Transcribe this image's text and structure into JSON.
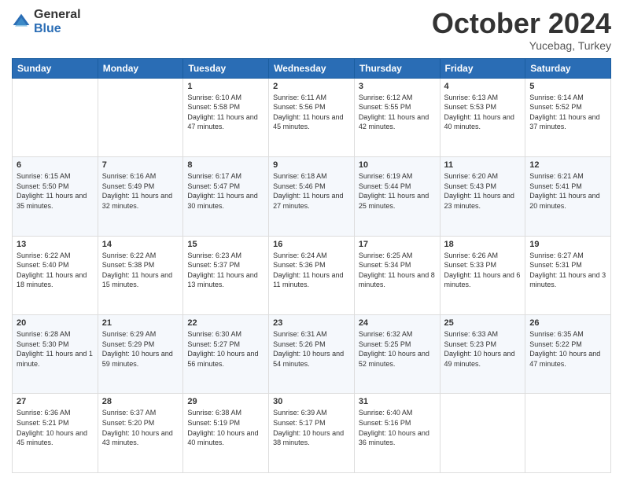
{
  "logo": {
    "general": "General",
    "blue": "Blue"
  },
  "header": {
    "month": "October 2024",
    "location": "Yucebag, Turkey"
  },
  "days": [
    "Sunday",
    "Monday",
    "Tuesday",
    "Wednesday",
    "Thursday",
    "Friday",
    "Saturday"
  ],
  "weeks": [
    [
      {
        "day": "",
        "sunrise": "",
        "sunset": "",
        "daylight": ""
      },
      {
        "day": "",
        "sunrise": "",
        "sunset": "",
        "daylight": ""
      },
      {
        "day": "1",
        "sunrise": "Sunrise: 6:10 AM",
        "sunset": "Sunset: 5:58 PM",
        "daylight": "Daylight: 11 hours and 47 minutes."
      },
      {
        "day": "2",
        "sunrise": "Sunrise: 6:11 AM",
        "sunset": "Sunset: 5:56 PM",
        "daylight": "Daylight: 11 hours and 45 minutes."
      },
      {
        "day": "3",
        "sunrise": "Sunrise: 6:12 AM",
        "sunset": "Sunset: 5:55 PM",
        "daylight": "Daylight: 11 hours and 42 minutes."
      },
      {
        "day": "4",
        "sunrise": "Sunrise: 6:13 AM",
        "sunset": "Sunset: 5:53 PM",
        "daylight": "Daylight: 11 hours and 40 minutes."
      },
      {
        "day": "5",
        "sunrise": "Sunrise: 6:14 AM",
        "sunset": "Sunset: 5:52 PM",
        "daylight": "Daylight: 11 hours and 37 minutes."
      }
    ],
    [
      {
        "day": "6",
        "sunrise": "Sunrise: 6:15 AM",
        "sunset": "Sunset: 5:50 PM",
        "daylight": "Daylight: 11 hours and 35 minutes."
      },
      {
        "day": "7",
        "sunrise": "Sunrise: 6:16 AM",
        "sunset": "Sunset: 5:49 PM",
        "daylight": "Daylight: 11 hours and 32 minutes."
      },
      {
        "day": "8",
        "sunrise": "Sunrise: 6:17 AM",
        "sunset": "Sunset: 5:47 PM",
        "daylight": "Daylight: 11 hours and 30 minutes."
      },
      {
        "day": "9",
        "sunrise": "Sunrise: 6:18 AM",
        "sunset": "Sunset: 5:46 PM",
        "daylight": "Daylight: 11 hours and 27 minutes."
      },
      {
        "day": "10",
        "sunrise": "Sunrise: 6:19 AM",
        "sunset": "Sunset: 5:44 PM",
        "daylight": "Daylight: 11 hours and 25 minutes."
      },
      {
        "day": "11",
        "sunrise": "Sunrise: 6:20 AM",
        "sunset": "Sunset: 5:43 PM",
        "daylight": "Daylight: 11 hours and 23 minutes."
      },
      {
        "day": "12",
        "sunrise": "Sunrise: 6:21 AM",
        "sunset": "Sunset: 5:41 PM",
        "daylight": "Daylight: 11 hours and 20 minutes."
      }
    ],
    [
      {
        "day": "13",
        "sunrise": "Sunrise: 6:22 AM",
        "sunset": "Sunset: 5:40 PM",
        "daylight": "Daylight: 11 hours and 18 minutes."
      },
      {
        "day": "14",
        "sunrise": "Sunrise: 6:22 AM",
        "sunset": "Sunset: 5:38 PM",
        "daylight": "Daylight: 11 hours and 15 minutes."
      },
      {
        "day": "15",
        "sunrise": "Sunrise: 6:23 AM",
        "sunset": "Sunset: 5:37 PM",
        "daylight": "Daylight: 11 hours and 13 minutes."
      },
      {
        "day": "16",
        "sunrise": "Sunrise: 6:24 AM",
        "sunset": "Sunset: 5:36 PM",
        "daylight": "Daylight: 11 hours and 11 minutes."
      },
      {
        "day": "17",
        "sunrise": "Sunrise: 6:25 AM",
        "sunset": "Sunset: 5:34 PM",
        "daylight": "Daylight: 11 hours and 8 minutes."
      },
      {
        "day": "18",
        "sunrise": "Sunrise: 6:26 AM",
        "sunset": "Sunset: 5:33 PM",
        "daylight": "Daylight: 11 hours and 6 minutes."
      },
      {
        "day": "19",
        "sunrise": "Sunrise: 6:27 AM",
        "sunset": "Sunset: 5:31 PM",
        "daylight": "Daylight: 11 hours and 3 minutes."
      }
    ],
    [
      {
        "day": "20",
        "sunrise": "Sunrise: 6:28 AM",
        "sunset": "Sunset: 5:30 PM",
        "daylight": "Daylight: 11 hours and 1 minute."
      },
      {
        "day": "21",
        "sunrise": "Sunrise: 6:29 AM",
        "sunset": "Sunset: 5:29 PM",
        "daylight": "Daylight: 10 hours and 59 minutes."
      },
      {
        "day": "22",
        "sunrise": "Sunrise: 6:30 AM",
        "sunset": "Sunset: 5:27 PM",
        "daylight": "Daylight: 10 hours and 56 minutes."
      },
      {
        "day": "23",
        "sunrise": "Sunrise: 6:31 AM",
        "sunset": "Sunset: 5:26 PM",
        "daylight": "Daylight: 10 hours and 54 minutes."
      },
      {
        "day": "24",
        "sunrise": "Sunrise: 6:32 AM",
        "sunset": "Sunset: 5:25 PM",
        "daylight": "Daylight: 10 hours and 52 minutes."
      },
      {
        "day": "25",
        "sunrise": "Sunrise: 6:33 AM",
        "sunset": "Sunset: 5:23 PM",
        "daylight": "Daylight: 10 hours and 49 minutes."
      },
      {
        "day": "26",
        "sunrise": "Sunrise: 6:35 AM",
        "sunset": "Sunset: 5:22 PM",
        "daylight": "Daylight: 10 hours and 47 minutes."
      }
    ],
    [
      {
        "day": "27",
        "sunrise": "Sunrise: 6:36 AM",
        "sunset": "Sunset: 5:21 PM",
        "daylight": "Daylight: 10 hours and 45 minutes."
      },
      {
        "day": "28",
        "sunrise": "Sunrise: 6:37 AM",
        "sunset": "Sunset: 5:20 PM",
        "daylight": "Daylight: 10 hours and 43 minutes."
      },
      {
        "day": "29",
        "sunrise": "Sunrise: 6:38 AM",
        "sunset": "Sunset: 5:19 PM",
        "daylight": "Daylight: 10 hours and 40 minutes."
      },
      {
        "day": "30",
        "sunrise": "Sunrise: 6:39 AM",
        "sunset": "Sunset: 5:17 PM",
        "daylight": "Daylight: 10 hours and 38 minutes."
      },
      {
        "day": "31",
        "sunrise": "Sunrise: 6:40 AM",
        "sunset": "Sunset: 5:16 PM",
        "daylight": "Daylight: 10 hours and 36 minutes."
      },
      {
        "day": "",
        "sunrise": "",
        "sunset": "",
        "daylight": ""
      },
      {
        "day": "",
        "sunrise": "",
        "sunset": "",
        "daylight": ""
      }
    ]
  ]
}
